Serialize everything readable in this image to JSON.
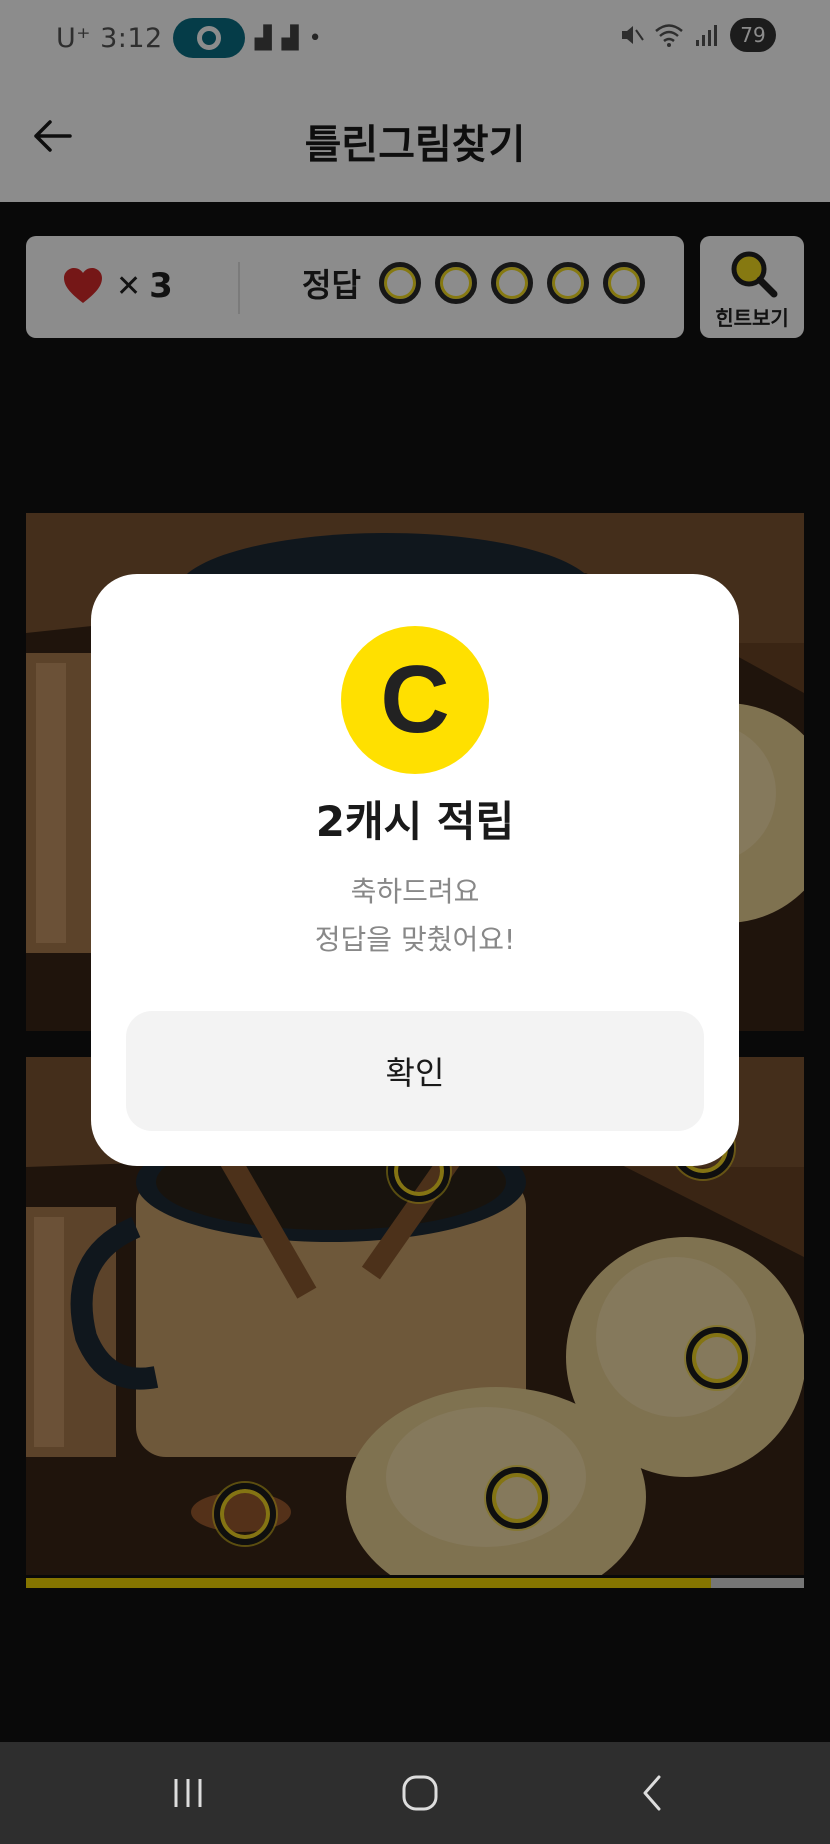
{
  "status_bar": {
    "carrier": "U⁺ 3:12",
    "battery": "79",
    "icons": [
      "notification-app-icon",
      "notification-icon",
      "notification-icon",
      "dot-icon",
      "mute-icon",
      "wifi-icon",
      "signal-icon",
      "battery-icon"
    ]
  },
  "header": {
    "title": "틀린그림찾기",
    "back_icon": "arrow-left-icon"
  },
  "score": {
    "lives_icon": "heart-icon",
    "lives_x": "✕",
    "lives_count": "3",
    "answers_label": "정답",
    "answers_total": 5,
    "answers_found": 5
  },
  "hint": {
    "icon": "magnifier-icon",
    "label": "힌트보기"
  },
  "game": {
    "progress": 0.88,
    "accent_color": "#f3d600"
  },
  "modal": {
    "coin_letter": "C",
    "title": "2캐시 적립",
    "message_line1": "축하드려요",
    "message_line2": "정답을 맞췄어요!",
    "confirm_label": "확인"
  },
  "nav_bar": {
    "icons": [
      "recent-apps-icon",
      "home-icon",
      "back-icon"
    ]
  }
}
